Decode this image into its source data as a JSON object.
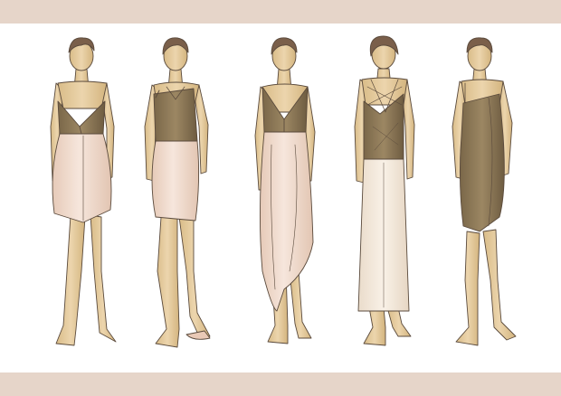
{
  "illustration": {
    "subject": "fashion-sketch-lineup",
    "figures": [
      {
        "name": "figure-1",
        "garment": "v-neck-asymmetric-hem-dress"
      },
      {
        "name": "figure-2",
        "garment": "one-shoulder-pencil-dress"
      },
      {
        "name": "figure-3",
        "garment": "empire-waist-draped-dress"
      },
      {
        "name": "figure-4",
        "garment": "strappy-bodice-maxi-dress"
      },
      {
        "name": "figure-5",
        "garment": "one-strap-taupe-mini-dress"
      }
    ]
  },
  "colors": {
    "border": "#e6d5c9",
    "paper": "#ffffff",
    "skin": "#e8cfa3",
    "skin_shadow": "#cfb07c",
    "taupe": "#8f7a59",
    "taupe_dark": "#6e5c41",
    "blush": "#f3e1d6",
    "blush_shadow": "#e5c9b8",
    "cream": "#f6ece1",
    "hair": "#7a5f4a",
    "line": "#5a4a3c"
  }
}
